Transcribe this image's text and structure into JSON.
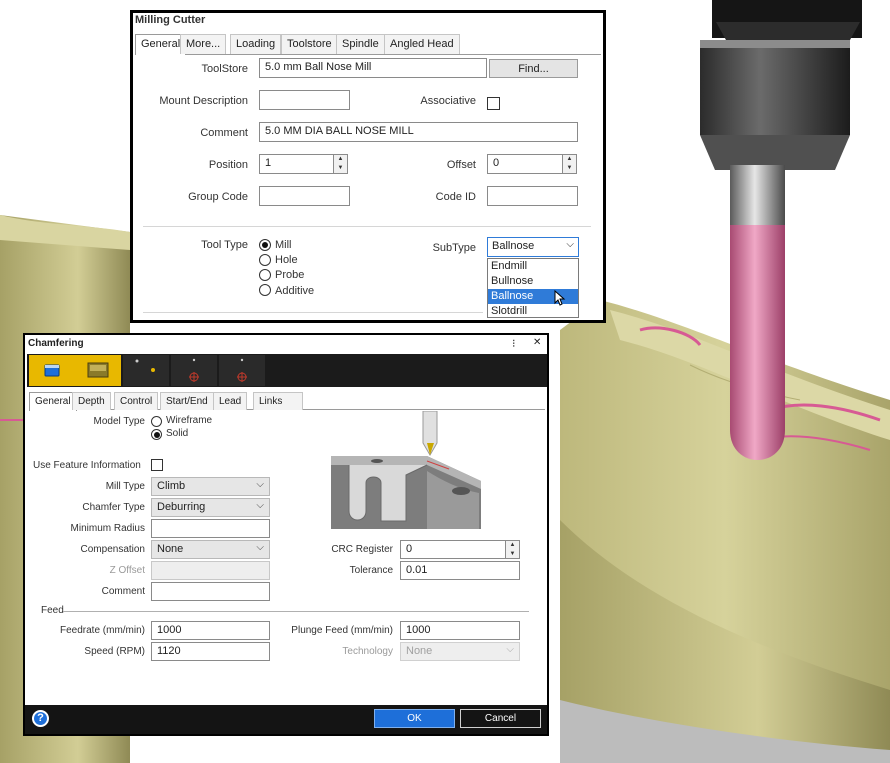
{
  "milling": {
    "title": "Milling Cutter",
    "tabs": [
      "General",
      "More...",
      "Loading",
      "Toolstore",
      "Spindle",
      "Angled Head"
    ],
    "toolstore_label": "ToolStore",
    "toolstore_value": "5.0 mm Ball Nose Mill",
    "find_label": "Find...",
    "mount_label": "Mount Description",
    "mount_value": "",
    "associative_label": "Associative",
    "comment_label": "Comment",
    "comment_value": "5.0 MM DIA BALL NOSE MILL",
    "position_label": "Position",
    "position_value": "1",
    "offset_label": "Offset",
    "offset_value": "0",
    "group_label": "Group Code",
    "group_value": "",
    "codeid_label": "Code ID",
    "codeid_value": "",
    "tooltype_label": "Tool Type",
    "tooltypes": [
      "Mill",
      "Hole",
      "Probe",
      "Additive"
    ],
    "tooltype_selected": "Mill",
    "subtype_label": "SubType",
    "subtype_value": "Ballnose",
    "subtype_options": [
      "Endmill",
      "Bullnose",
      "Ballnose",
      "Slotdrill"
    ],
    "subtype_highlighted": "Ballnose"
  },
  "chamfering": {
    "title": "Chamfering",
    "tabs": [
      "General",
      "Depth",
      "Control",
      "Start/End",
      "Lead",
      "Links"
    ],
    "model_type_label": "Model Type",
    "model_types": [
      "Wireframe",
      "Solid"
    ],
    "model_type_selected": "Solid",
    "use_feature_label": "Use Feature Information",
    "mill_type_label": "Mill Type",
    "mill_type_value": "Climb",
    "chamfer_type_label": "Chamfer Type",
    "chamfer_type_value": "Deburring",
    "min_radius_label": "Minimum Radius",
    "min_radius_value": "",
    "compensation_label": "Compensation",
    "compensation_value": "None",
    "z_offset_label": "Z Offset",
    "z_offset_value": "",
    "comment_label": "Comment",
    "comment_value": "",
    "crc_label": "CRC Register",
    "crc_value": "0",
    "tolerance_label": "Tolerance",
    "tolerance_value": "0.01",
    "feed_section": "Feed",
    "feedrate_label": "Feedrate (mm/min)",
    "feedrate_value": "1000",
    "plunge_label": "Plunge Feed (mm/min)",
    "plunge_value": "1000",
    "speed_label": "Speed (RPM)",
    "speed_value": "1120",
    "technology_label": "Technology",
    "technology_value": "None",
    "ok_label": "OK",
    "cancel_label": "Cancel",
    "help_symbol": "?",
    "pin_symbol": "⁝",
    "close_symbol": "✕"
  },
  "colors": {
    "part_fill": "#c9c48a",
    "part_shadow": "#9c9860",
    "tool_shank": "#9a9a9a",
    "tool_tip": "#d9739b",
    "toolbar_bg": "#1b1b1b",
    "toolbar_active": "#e8b800",
    "accent_blue": "#1e6fd9",
    "selection_blue": "#2f7bd8"
  }
}
